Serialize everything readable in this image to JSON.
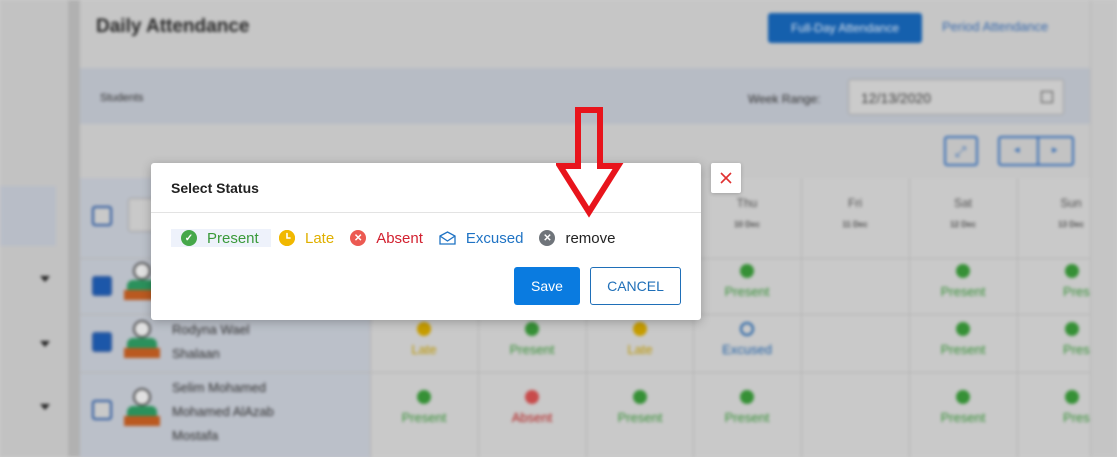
{
  "background": {
    "title": "Daily Attendance",
    "full_day_button": "Full-Day Attendance",
    "period_link": "Period Attendance",
    "students_label": "Students",
    "week_range_label": "Week Range:",
    "week_range_value": "12/13/2020",
    "days": [
      {
        "name": "Thu",
        "date": "10 Dec"
      },
      {
        "name": "Fri",
        "date": "11 Dec"
      },
      {
        "name": "Sat",
        "date": "12 Dec"
      },
      {
        "name": "Sun",
        "date": "13 Dec"
      }
    ],
    "students": [
      {
        "name_lines": [
          "",
          ""
        ]
      },
      {
        "name_lines": [
          "Rodyna Wael",
          "Shalaan"
        ]
      },
      {
        "name_lines": [
          "Selim Mohamed",
          "Mohamed AlAzab",
          "Mostafa"
        ]
      }
    ],
    "status_labels": {
      "present": "Present",
      "late": "Late",
      "absent": "Absent",
      "excused": "Excused",
      "present_clipped": "Prese"
    }
  },
  "modal": {
    "title": "Select Status",
    "options": {
      "present": "Present",
      "late": "Late",
      "absent": "Absent",
      "excused": "Excused",
      "remove": "remove"
    },
    "save_label": "Save",
    "cancel_label": "CANCEL"
  },
  "colors": {
    "present": "#46a84a",
    "late": "#f1b800",
    "absent": "#ec5a52",
    "excused": "#1f73c4",
    "remove": "#6f747a",
    "primary": "#0a7be0",
    "annotation_arrow": "#e8141c"
  },
  "icons": [
    "check-circle-icon",
    "clock-icon",
    "x-circle-icon",
    "envelope-icon",
    "remove-circle-icon",
    "close-icon",
    "down-arrow-annotation"
  ]
}
